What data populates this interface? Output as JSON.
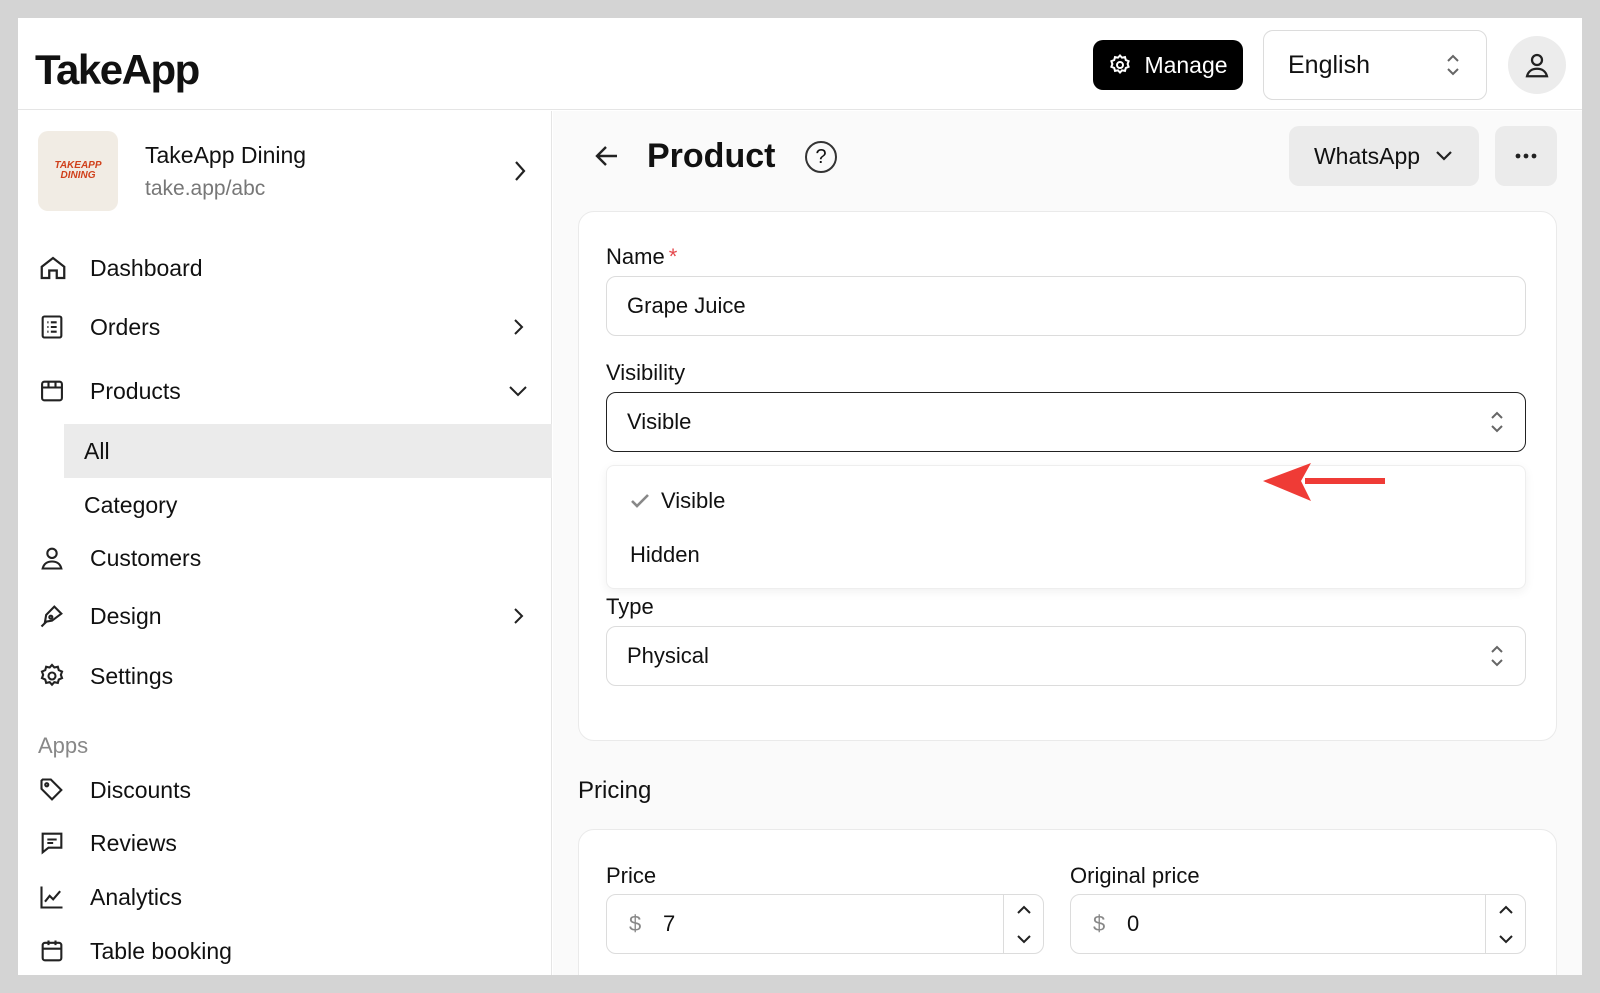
{
  "app": {
    "logo": "TakeApp"
  },
  "header": {
    "manage_label": "Manage",
    "language": "English"
  },
  "store": {
    "name": "TakeApp Dining",
    "url": "take.app/abc",
    "logo_text": "TAKEAPP DINING"
  },
  "sidebar": {
    "items": [
      {
        "label": "Dashboard",
        "icon": "home-icon"
      },
      {
        "label": "Orders",
        "icon": "orders-icon"
      },
      {
        "label": "Products",
        "icon": "box-icon"
      },
      {
        "label": "Customers",
        "icon": "user-icon"
      },
      {
        "label": "Design",
        "icon": "pen-icon"
      },
      {
        "label": "Settings",
        "icon": "gear-icon"
      }
    ],
    "product_sub": [
      "All",
      "Category"
    ],
    "apps_label": "Apps",
    "apps": [
      {
        "label": "Discounts",
        "icon": "tag-icon"
      },
      {
        "label": "Reviews",
        "icon": "review-icon"
      },
      {
        "label": "Analytics",
        "icon": "chart-icon"
      },
      {
        "label": "Table booking",
        "icon": "calendar-icon"
      }
    ]
  },
  "main": {
    "title": "Product",
    "whatsapp_label": "WhatsApp",
    "form": {
      "name_label": "Name",
      "name_required": "*",
      "name_value": "Grape Juice",
      "visibility_label": "Visibility",
      "visibility_value": "Visible",
      "visibility_options": [
        "Visible",
        "Hidden"
      ],
      "type_label": "Type",
      "type_value": "Physical"
    },
    "pricing": {
      "title": "Pricing",
      "price_label": "Price",
      "price_currency": "$",
      "price_value": "7",
      "original_label": "Original price",
      "original_currency": "$",
      "original_value": "0"
    }
  },
  "colors": {
    "accent": "#000000",
    "annotation": "#ef3b36",
    "active_bg": "#ebebeb"
  }
}
